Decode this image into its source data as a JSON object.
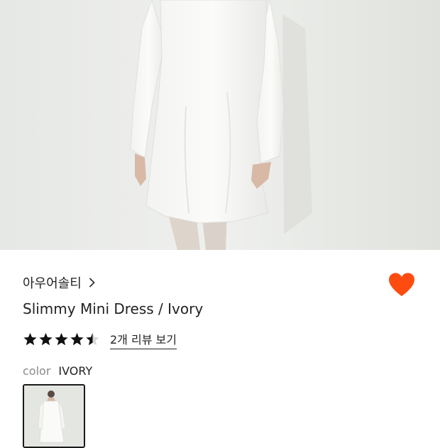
{
  "product": {
    "brand_name": "아우어솔티",
    "title": "Slimmy Mini Dress / Ivory",
    "rating": 4.5,
    "rating_max": 5,
    "reviews_link": "2개 리뷰 보기",
    "color_label": "color",
    "color_value": "IVORY",
    "favorited": true
  },
  "icons": {
    "brand_chevron": "chevron-right-icon",
    "favorite": "heart-icon",
    "star": "star-icon"
  },
  "colors": {
    "heart": "#fe4c11",
    "text_primary": "#222222",
    "text_muted": "#8a8a8a",
    "swatch_border": "#1a1a1a"
  }
}
